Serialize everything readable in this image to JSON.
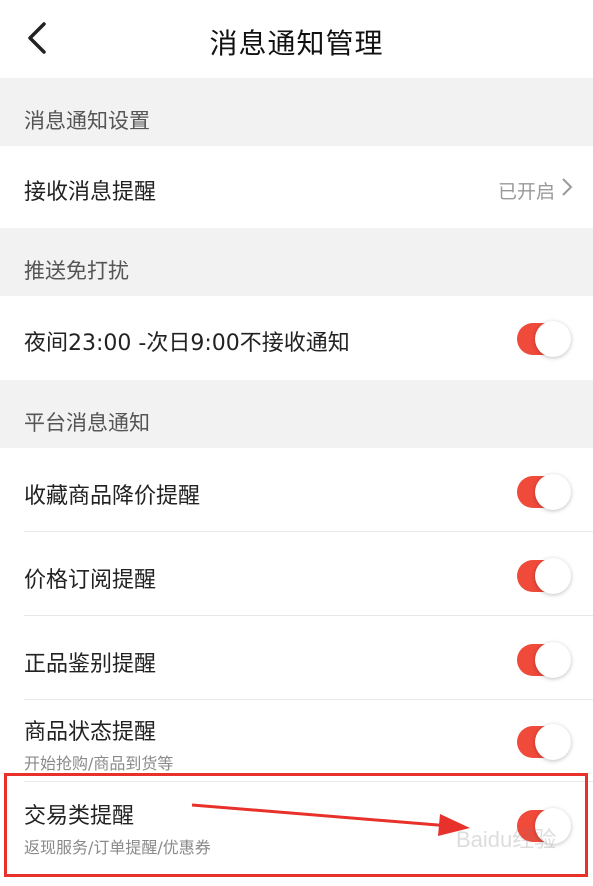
{
  "header": {
    "title": "消息通知管理"
  },
  "sections": {
    "notification_settings": "消息通知设置",
    "dnd": "推送免打扰",
    "platform": "平台消息通知"
  },
  "rows": {
    "receive": {
      "label": "接收消息提醒",
      "value": "已开启"
    },
    "night": {
      "label": "夜间23:00 -次日9:00不接收通知",
      "enabled": true
    },
    "fav_price_drop": {
      "label": "收藏商品降价提醒",
      "enabled": true
    },
    "price_subscribe": {
      "label": "价格订阅提醒",
      "enabled": true
    },
    "authenticity": {
      "label": "正品鉴别提醒",
      "enabled": true
    },
    "product_status": {
      "label": "商品状态提醒",
      "sub": "开始抢购/商品到货等",
      "enabled": true
    },
    "transaction": {
      "label": "交易类提醒",
      "sub": "返现服务/订单提醒/优惠券",
      "enabled": true
    }
  },
  "watermark": "Baidu经验",
  "colors": {
    "accent": "#f04a3a",
    "annotation": "#e8312b"
  },
  "icons": {
    "back": "chevron-left-icon",
    "forward": "chevron-right-icon"
  }
}
